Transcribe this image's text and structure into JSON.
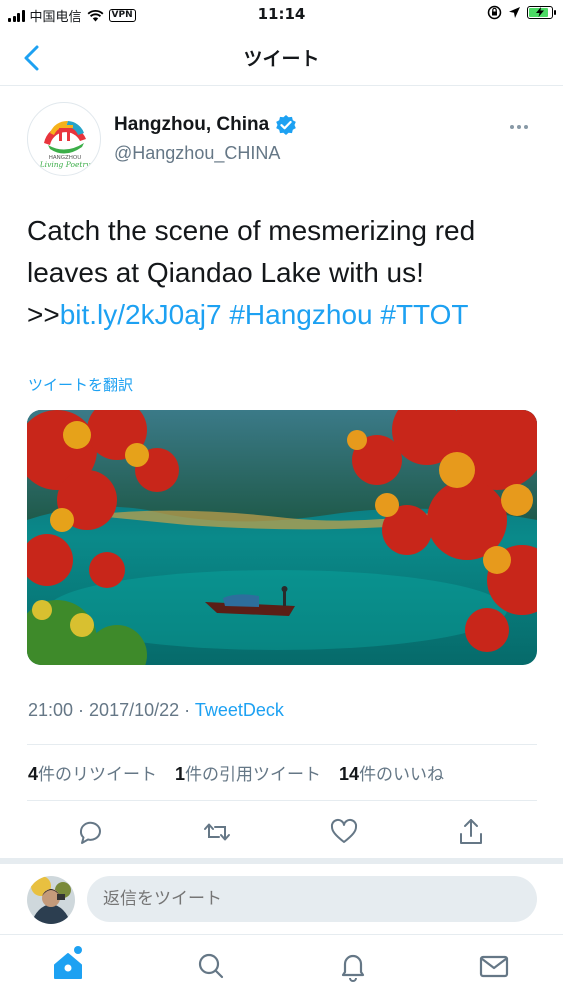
{
  "status_bar": {
    "carrier": "中国电信",
    "vpn": "VPN",
    "time": "11:14",
    "battery_level": 0.8
  },
  "nav": {
    "title": "ツイート"
  },
  "tweet": {
    "author_name": "Hangzhou, China",
    "author_handle": "@Hangzhou_CHINA",
    "text_line1": "Catch the scene of mesmerizing red",
    "text_line2": "leaves at Qiandao Lake with us!",
    "prefix": ">>",
    "link": "bit.ly/2kJ0aj7",
    "hashtag1": "#Hangzhou",
    "hashtag2": "#TTOT",
    "translate_label": "ツイートを翻訳",
    "time": "21:00",
    "date": "2017/10/22",
    "source": "TweetDeck",
    "retweets_count": "4",
    "retweets_label": "件のリツイート",
    "quotes_count": "1",
    "quotes_label": "件の引用ツイート",
    "likes_count": "14",
    "likes_label": "件のいいね"
  },
  "reply": {
    "placeholder": "返信をツイート"
  },
  "colors": {
    "accent": "#1da1f2",
    "text": "#14171a",
    "secondary": "#657786",
    "divider": "#e6ecf0"
  },
  "icons": {
    "back": "chevron-left-icon",
    "verified": "verified-badge-icon",
    "more": "more-dots-icon",
    "reply": "reply-icon",
    "retweet": "retweet-icon",
    "like": "heart-icon",
    "share": "share-icon",
    "home": "home-icon",
    "search": "search-icon",
    "notifications": "bell-icon",
    "messages": "mail-icon"
  }
}
